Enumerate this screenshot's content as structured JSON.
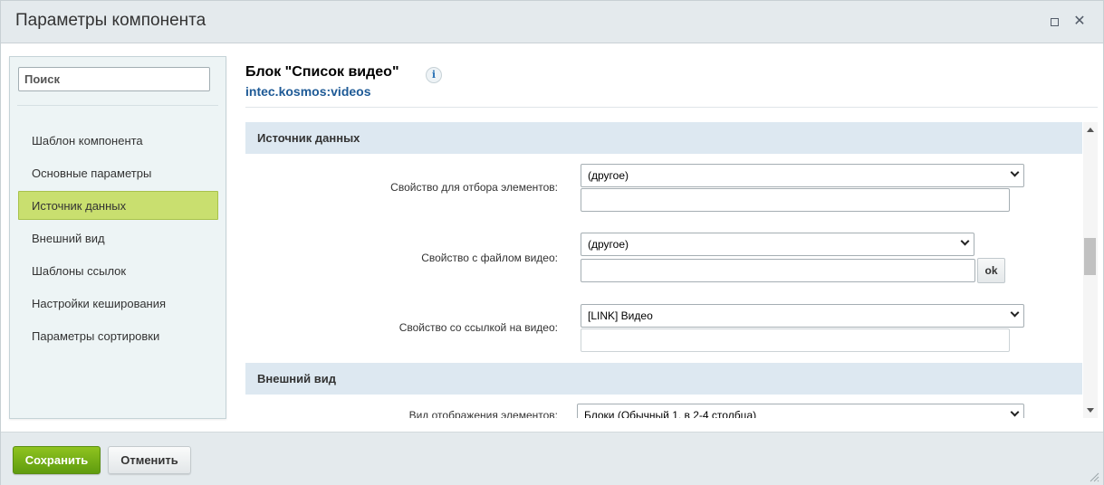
{
  "dialog": {
    "title": "Параметры компонента",
    "maximize_icon": "maximize-icon",
    "close_icon": "close-icon",
    "close_glyph": "✕"
  },
  "sidebar": {
    "search_placeholder": "Поиск",
    "items": [
      {
        "label": "Шаблон компонента"
      },
      {
        "label": "Основные параметры"
      },
      {
        "label": "Источник данных",
        "active": true
      },
      {
        "label": "Внешний вид"
      },
      {
        "label": "Шаблоны ссылок"
      },
      {
        "label": "Настройки кеширования"
      },
      {
        "label": "Параметры сортировки"
      }
    ]
  },
  "header": {
    "title": "Блок \"Список видео\"",
    "info_glyph": "i",
    "component_id": "intec.kosmos:videos"
  },
  "sections": [
    {
      "title": "Источник данных",
      "props": [
        {
          "label": "Свойство для отбора элементов:",
          "select_value": "(другое)",
          "text_value": ""
        },
        {
          "label": "Свойство с файлом видео:",
          "select_value": "(другое)",
          "text_value": "",
          "ok_label": "ok"
        },
        {
          "label": "Свойство со ссылкой на видео:",
          "select_value": "[LINK] Видео",
          "text_value": ""
        }
      ]
    },
    {
      "title": "Внешний вид",
      "props": [
        {
          "label": "Вид отображения элементов:",
          "select_value": "Блоки (Обычный 1, в 2-4 столбца)"
        }
      ]
    }
  ],
  "footer": {
    "save_label": "Сохранить",
    "cancel_label": "Отменить"
  },
  "colors": {
    "accent_green": "#6fae14",
    "active_nav": "#c9df6f",
    "section_bg": "#dde8f1",
    "link_blue": "#1e5a96"
  }
}
